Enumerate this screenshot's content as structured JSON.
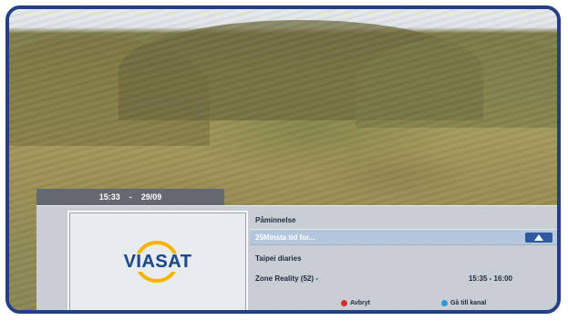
{
  "datetime": {
    "time": "15:33",
    "separator": "-",
    "date": "29/09"
  },
  "logo": {
    "text": "VIASAT"
  },
  "reminder": {
    "title": "Påminnelse",
    "selected_item": "25Minsta tid for...",
    "program": "Taipei diaries",
    "channel": "Zone Reality  (52) -",
    "time_range": "15:35 - 16:00"
  },
  "actions": {
    "cancel_label": "Avbryt",
    "goto_label": "Gå till kanal"
  },
  "colors": {
    "frame": "#243f86",
    "accent": "#2f5aa0",
    "cancel": "#d62b2b",
    "goto": "#2a9ad8"
  },
  "icons": {
    "up_arrow": "up-arrow-icon",
    "cancel": "red-button-icon",
    "goto": "blue-button-icon"
  }
}
